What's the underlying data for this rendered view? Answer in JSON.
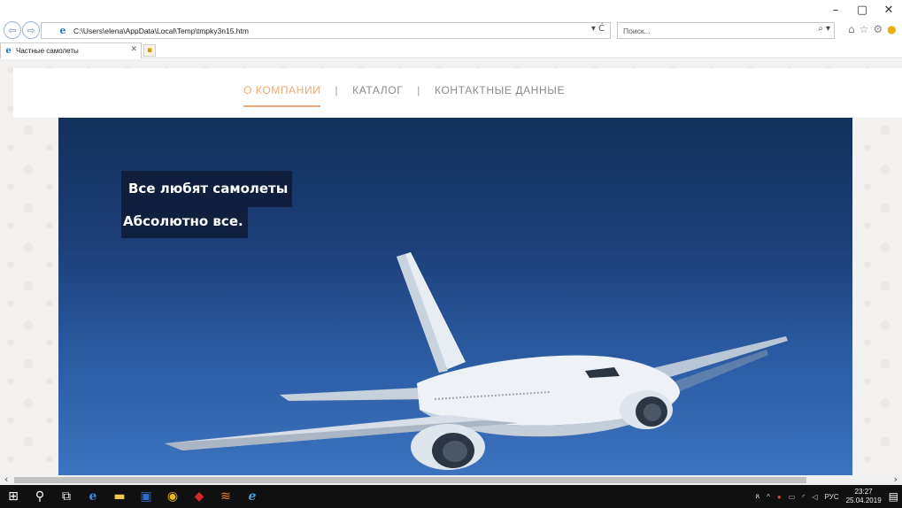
{
  "browser": {
    "window_controls": {
      "minimize": "–",
      "maximize": "▢",
      "close": "✕"
    },
    "address": "C:\\Users\\elena\\AppData\\Local\\Temp\\tmpky3n15.htm",
    "address_tools": "▾ Ċ",
    "search_placeholder": "Поиск...",
    "search_glyph": "⌕ ▾",
    "tab": {
      "title": "Частные самолеты",
      "close": "✕"
    },
    "scroll_left": "‹",
    "scroll_right": "›"
  },
  "site": {
    "nav": [
      {
        "label": "О КОМПАНИИ",
        "active": true
      },
      {
        "label": "КАТАЛОГ",
        "active": false
      },
      {
        "label": "КОНТАКТНЫЕ ДАННЫЕ",
        "active": false
      }
    ],
    "nav_separator": "|",
    "hero": {
      "caption_line1": "Все любят самолеты",
      "caption_line2": "Абсолютно все."
    }
  },
  "taskbar": {
    "apps": [
      "start-icon",
      "search-icon",
      "task-view-icon",
      "edge-icon",
      "file-explorer-icon",
      "word-icon",
      "chrome-icon",
      "mcafee-icon",
      "sublime-icon",
      "internet-explorer-icon"
    ],
    "tray": {
      "people_glyph": "ጸ",
      "chevron": "^",
      "language": "РУС"
    },
    "time": "23:27",
    "date": "25.04.2019"
  },
  "colors": {
    "accent_nav": "#f0a878",
    "hero_top": "#14305c",
    "hero_bottom": "#3c73be",
    "taskbar": "#101010"
  }
}
